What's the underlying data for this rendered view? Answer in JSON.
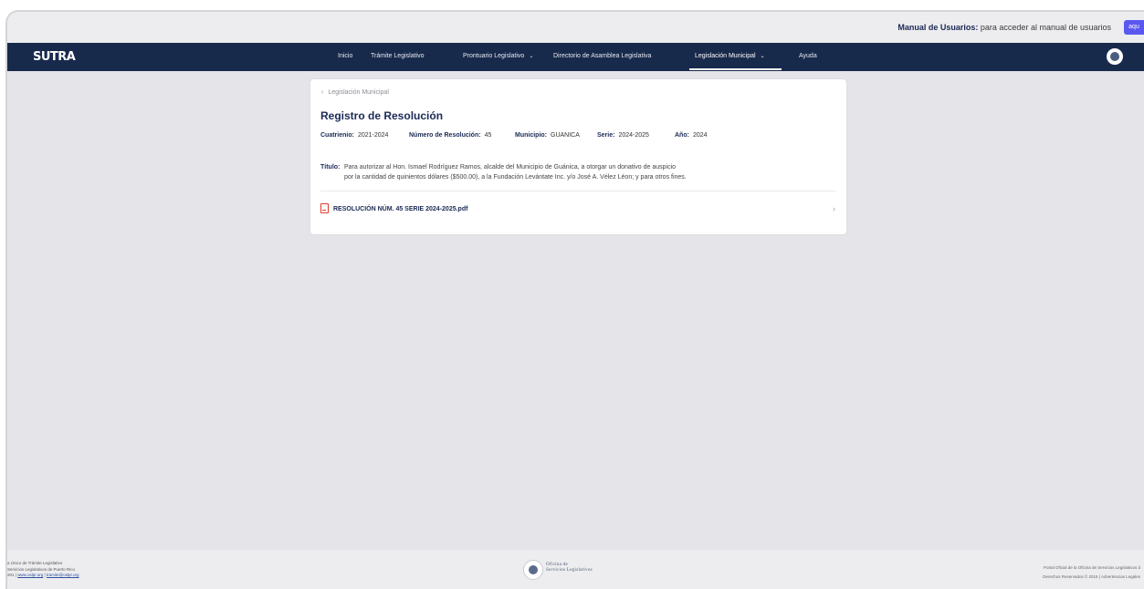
{
  "topbar": {
    "manual_bold": "Manual de Usuarios:",
    "manual_text": " para acceder al manual de usuarios",
    "manual_button": "aqu"
  },
  "nav": {
    "logo": "SUTRA",
    "items": [
      {
        "label": "Inicio"
      },
      {
        "label": "Trámite Legislativo"
      },
      {
        "label": "Prontuario Legislativo"
      },
      {
        "label": "Directorio de Asamblea Legislativa"
      },
      {
        "label": "Legislación Municipal"
      },
      {
        "label": "Ayuda"
      }
    ],
    "caret": "⌄",
    "active": "Legislación Municipal"
  },
  "card": {
    "breadcrumb": "Legislación Municipal",
    "breadcrumb_icon": "chevron-left-icon",
    "title": "Registro de Resolución",
    "meta": {
      "cuatrienio_label": "Cuatrienio:",
      "cuatrienio": "2021-2024",
      "numero_label": "Número de Resolución:",
      "numero": "45",
      "municipio_label": "Municipio:",
      "municipio": "GUANICA",
      "serie_label": "Serie:",
      "serie": "2024-2025",
      "ano_label": "Año:",
      "ano": "2024"
    },
    "titulo_label": "Título:",
    "titulo_line1": "Para autorizar al Hon. Ismael Rodríguez Ramos, alcalde del Municipio de Guánica, a otorgar un donativo de auspicio",
    "titulo_line2": "por la cantidad de quinientos dólares ($500.00), a la Fundación Levántate Inc. y/o José A. Vélez Léon; y para otros fines.",
    "document": "RESOLUCIÓN NÚM. 45 SERIE 2024-2025.pdf",
    "document_icon": "pdf-file-icon"
  },
  "footer": {
    "left_line1": "a Único de Trámite Legislativo",
    "left_line2": "Servicios Legislativos de Puerto Rico",
    "left_line3": "201 | ",
    "left_link1": "www.oslpr.org",
    "left_sep": " | ",
    "left_link2": "tramite@oslpr.org",
    "logo_line1": "Oficina de",
    "logo_line2": "Servicios Legislativos",
    "right_line1": "Portal Oficial de la Oficina de Servicios Legislativos d",
    "right_line2": "Derechos Reservados © 2016 | Advertencias Legales"
  },
  "colors": {
    "navbar": "#182a4c",
    "accent": "#5a58f0",
    "title": "#1b2a55",
    "pdf": "#e33b2b",
    "background": "#e5e5e9"
  }
}
